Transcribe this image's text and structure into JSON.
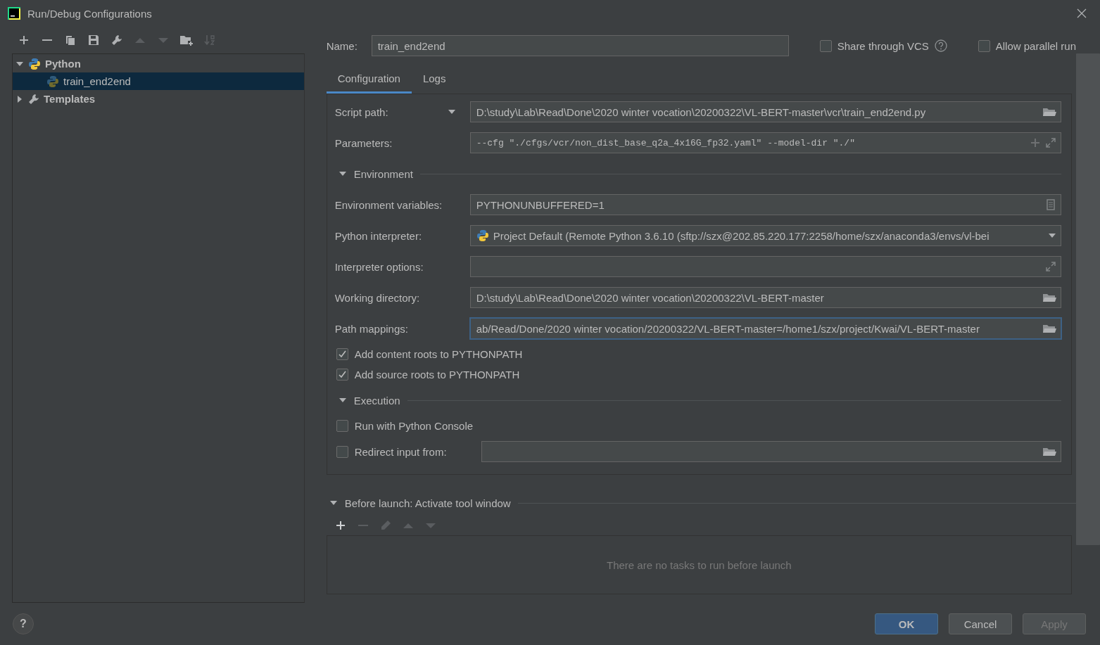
{
  "window": {
    "title": "Run/Debug Configurations"
  },
  "toolbar": [
    {
      "kind": "add",
      "disabled": false
    },
    {
      "kind": "remove",
      "disabled": false
    },
    {
      "kind": "copy",
      "disabled": false
    },
    {
      "kind": "save",
      "disabled": false
    },
    {
      "kind": "wrench",
      "disabled": false
    },
    {
      "kind": "up",
      "disabled": true
    },
    {
      "kind": "down",
      "disabled": true
    },
    {
      "kind": "folder-add",
      "disabled": false
    },
    {
      "kind": "sort",
      "disabled": true
    }
  ],
  "tree": [
    {
      "label": "Python",
      "kind": "python",
      "expanded": true,
      "selected": false,
      "children": [
        {
          "label": "train_end2end",
          "kind": "python-file",
          "selected": true
        }
      ]
    },
    {
      "label": "Templates",
      "kind": "templates",
      "expanded": false,
      "selected": false
    }
  ],
  "name": {
    "label": "Name:",
    "value": "train_end2end"
  },
  "options": [
    {
      "label": "Share through VCS",
      "checked": false,
      "help": true
    },
    {
      "label": "Allow parallel run",
      "checked": false,
      "help": false
    }
  ],
  "tabs": [
    {
      "label": "Configuration",
      "selected": true
    },
    {
      "label": "Logs",
      "selected": false
    }
  ],
  "form": [
    {
      "kind": "path-field",
      "label": "Script path:",
      "menu": true,
      "value": "D:\\study\\Lab\\Read\\Done\\2020 winter vocation\\20200322\\VL-BERT-master\\vcr\\train_end2end.py",
      "focused": false
    },
    {
      "kind": "args-field",
      "label": "Parameters:",
      "menu": false,
      "value": "--cfg \"./cfgs/vcr/non_dist_base_q2a_4x16G_fp32.yaml\" --model-dir \"./\"",
      "focused": false
    },
    {
      "kind": "section",
      "label": "Environment",
      "expanded": true
    },
    {
      "kind": "env-field",
      "label": "Environment variables:",
      "menu": false,
      "value": "PYTHONUNBUFFERED=1",
      "focused": false
    },
    {
      "kind": "interpreter-field",
      "label": "Python interpreter:",
      "menu": false,
      "value": "Project Default (Remote Python 3.6.10 (sftp://szx@202.85.220.177:2258/home/szx/anaconda3/envs/vl-bei",
      "focused": false
    },
    {
      "kind": "expand-field",
      "label": "Interpreter options:",
      "menu": false,
      "focused": false
    },
    {
      "kind": "path-field",
      "label": "Working directory:",
      "menu": false,
      "value": "D:\\study\\Lab\\Read\\Done\\2020 winter vocation\\20200322\\VL-BERT-master",
      "focused": false
    },
    {
      "kind": "path-field",
      "label": "Path mappings:",
      "menu": false,
      "value": "ab/Read/Done/2020 winter vocation/20200322/VL-BERT-master=/home1/szx/project/Kwai/VL-BERT-master",
      "focused": true
    },
    {
      "kind": "checkbox",
      "label": "Add content roots to PYTHONPATH",
      "checked": true
    },
    {
      "kind": "checkbox",
      "label": "Add source roots to PYTHONPATH",
      "checked": true
    },
    {
      "kind": "section",
      "label": "Execution",
      "expanded": true
    },
    {
      "kind": "checkbox",
      "label": "Run with Python Console",
      "checked": false
    },
    {
      "kind": "checkbox-field",
      "label": "Redirect input from:",
      "checked": false
    }
  ],
  "before_launch": {
    "title": "Before launch: Activate tool window",
    "expanded": true,
    "toolbar": [
      {
        "kind": "add",
        "disabled": false
      },
      {
        "kind": "remove",
        "disabled": true
      },
      {
        "kind": "edit",
        "disabled": true
      },
      {
        "kind": "up",
        "disabled": true
      },
      {
        "kind": "down",
        "disabled": true
      }
    ],
    "empty_text": "There are no tasks to run before launch"
  },
  "help_button": "?",
  "buttons": [
    {
      "label": "OK",
      "kind": "primary",
      "disabled": false
    },
    {
      "label": "Cancel",
      "kind": "normal",
      "disabled": false
    },
    {
      "label": "Apply",
      "kind": "normal",
      "disabled": true
    }
  ]
}
